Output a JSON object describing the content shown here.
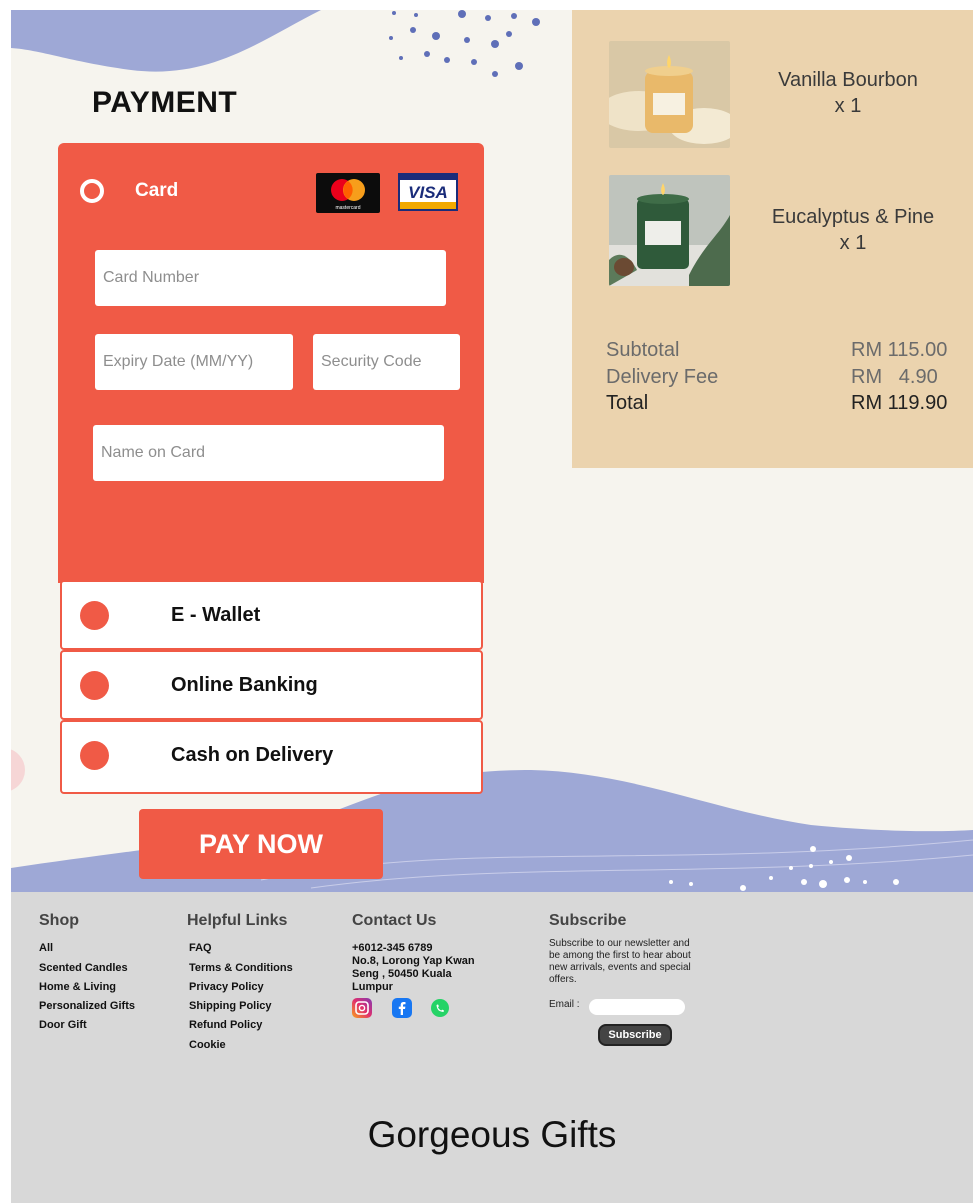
{
  "payment": {
    "title": "PAYMENT",
    "card": {
      "label": "Card",
      "card_number_placeholder": "Card Number",
      "expiry_placeholder": "Expiry Date (MM/YY)",
      "security_placeholder": "Security Code",
      "name_placeholder": "Name on Card",
      "mastercard_text": "mastercard",
      "visa_text": "VISA"
    },
    "options": [
      {
        "label": "E - Wallet"
      },
      {
        "label": "Online Banking"
      },
      {
        "label": "Cash on Delivery"
      }
    ],
    "pay_button": "PAY NOW"
  },
  "order": {
    "items": [
      {
        "name": "Vanilla Bourbon",
        "qty": "x 1"
      },
      {
        "name": "Eucalyptus & Pine",
        "qty": "x 1"
      }
    ],
    "subtotal_label": "Subtotal",
    "subtotal_value": "RM 115.00",
    "delivery_label": "Delivery Fee",
    "delivery_value": "RM   4.90",
    "total_label": "Total",
    "total_value": "RM 119.90"
  },
  "footer": {
    "shop": {
      "heading": "Shop",
      "links": [
        "All",
        "Scented Candles",
        "Home & Living",
        "Personalized Gifts",
        "Door Gift"
      ]
    },
    "helpful": {
      "heading": "Helpful Links",
      "links": [
        "FAQ",
        "Terms & Conditions",
        "Privacy Policy",
        "Shipping Policy",
        "Refund Policy",
        "Cookie"
      ]
    },
    "contact": {
      "heading": "Contact Us",
      "phone": "+6012-345 6789",
      "address_1": "No.8, Lorong Yap Kwan",
      "address_2": "Seng , 50450 Kuala",
      "address_3": "Lumpur"
    },
    "subscribe": {
      "heading": "Subscribe",
      "line_1": "Subscribe to our newsletter and",
      "line_2": "be among the first to hear about",
      "line_3": "new arrivals, events and special",
      "line_4": "offers.",
      "email_label": "Email :",
      "button": "Subscribe"
    },
    "brand": "Gorgeous Gifts"
  },
  "colors": {
    "accent": "#f05a46",
    "summary_bg": "#ebd3ae",
    "wave": "#9ea8d6",
    "footer_bg": "#d8d8d8"
  }
}
